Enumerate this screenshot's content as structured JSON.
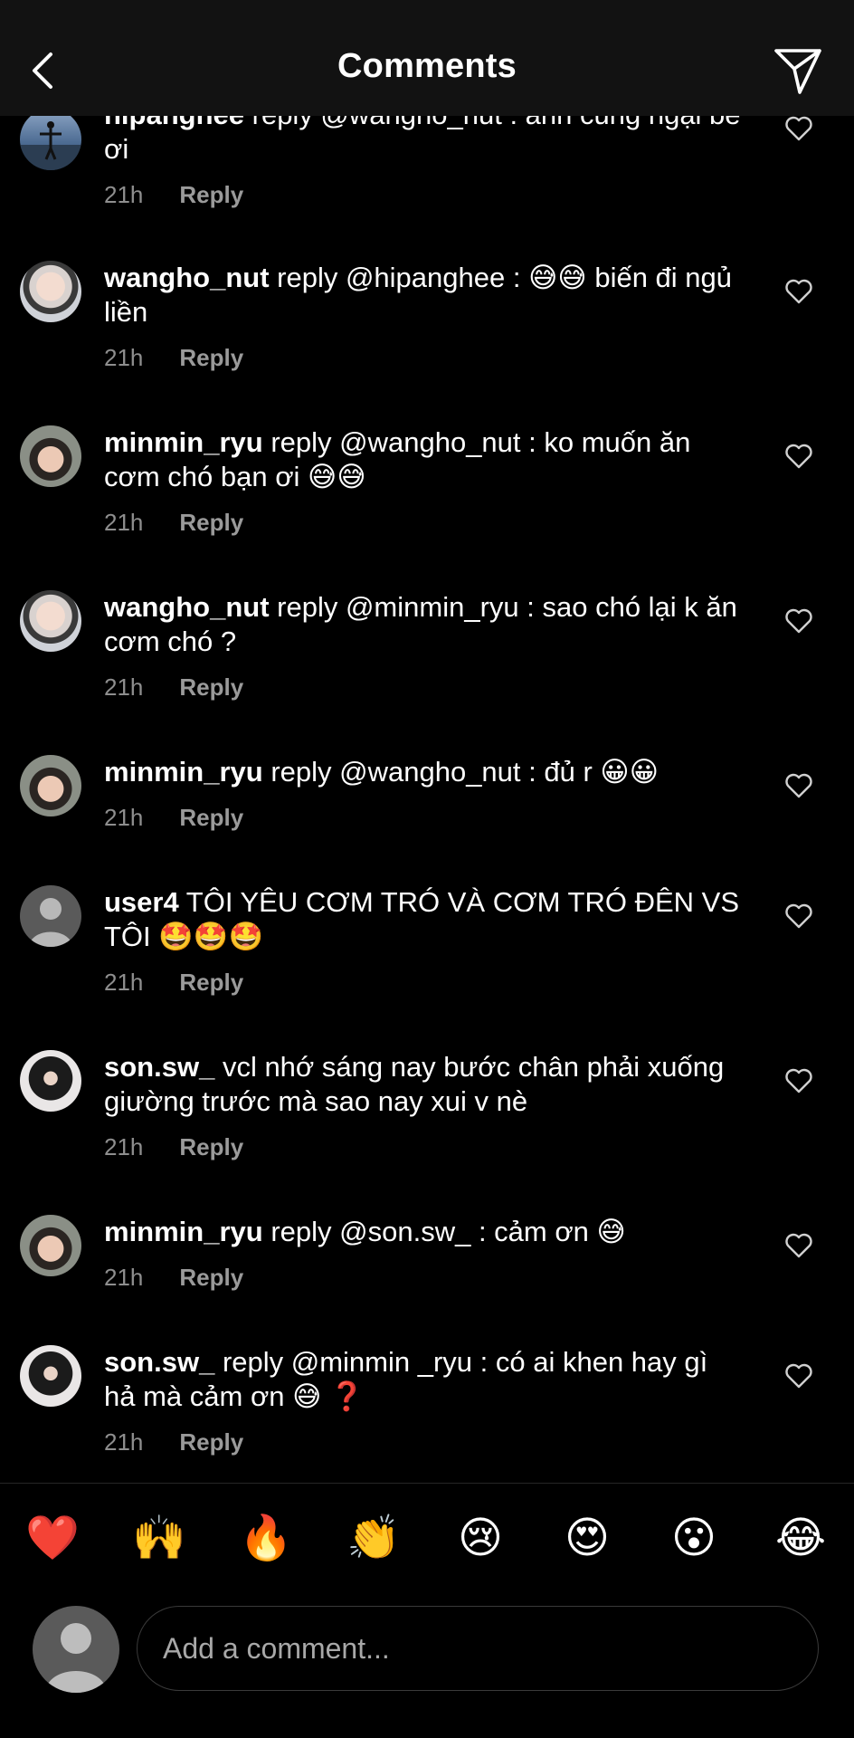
{
  "header": {
    "title": "Comments"
  },
  "comments": [
    {
      "username": "hipanghee",
      "text": " reply @wangho_nut : anh cũng ngại bé ơi",
      "time": "21h",
      "reply_label": "Reply",
      "avatar": "hipanghee-avatar"
    },
    {
      "username": "wangho_nut",
      "text": " reply @hipanghee : 😅😅 biến đi ngủ liền",
      "time": "21h",
      "reply_label": "Reply",
      "avatar": "wangho-avatar"
    },
    {
      "username": "minmin_ryu",
      "text": " reply @wangho_nut : ko muốn ăn cơm chó bạn ơi 😅😅",
      "time": "21h",
      "reply_label": "Reply",
      "avatar": "minmin-avatar"
    },
    {
      "username": "wangho_nut",
      "text": " reply @minmin_ryu : sao chó lại k ăn cơm chó ?",
      "time": "21h",
      "reply_label": "Reply",
      "avatar": "wangho-avatar"
    },
    {
      "username": "minmin_ryu",
      "text": " reply @wangho_nut : đủ r 😀😀",
      "time": "21h",
      "reply_label": "Reply",
      "avatar": "minmin-avatar"
    },
    {
      "username": "user4",
      "text": " TÔI YÊU CƠM TRÓ VÀ CƠM TRÓ ĐÊN VS TÔI 🤩🤩🤩",
      "time": "21h",
      "reply_label": "Reply",
      "avatar": "default-avatar"
    },
    {
      "username": "son.sw_",
      "text": " vcl nhớ sáng nay bước chân phải xuống giường trước mà sao nay xui v nè",
      "time": "21h",
      "reply_label": "Reply",
      "avatar": "son-avatar"
    },
    {
      "username": "minmin_ryu",
      "text": " reply @son.sw_ : cảm ơn 😅",
      "time": "21h",
      "reply_label": "Reply",
      "avatar": "minmin-avatar"
    },
    {
      "username": "son.sw_",
      "text": " reply @minmin _ryu : có ai khen hay gì hả mà cảm ơn 😅 ❓",
      "time": "21h",
      "reply_label": "Reply",
      "avatar": "son-avatar"
    }
  ],
  "quick_emojis": [
    "❤️",
    "🙌",
    "🔥",
    "👏",
    "😢",
    "😍",
    "😮",
    "😂"
  ],
  "composer": {
    "placeholder": "Add a comment..."
  },
  "colors": {
    "background": "#000000",
    "header": "#121212",
    "meta_text": "#8e8e8e"
  }
}
